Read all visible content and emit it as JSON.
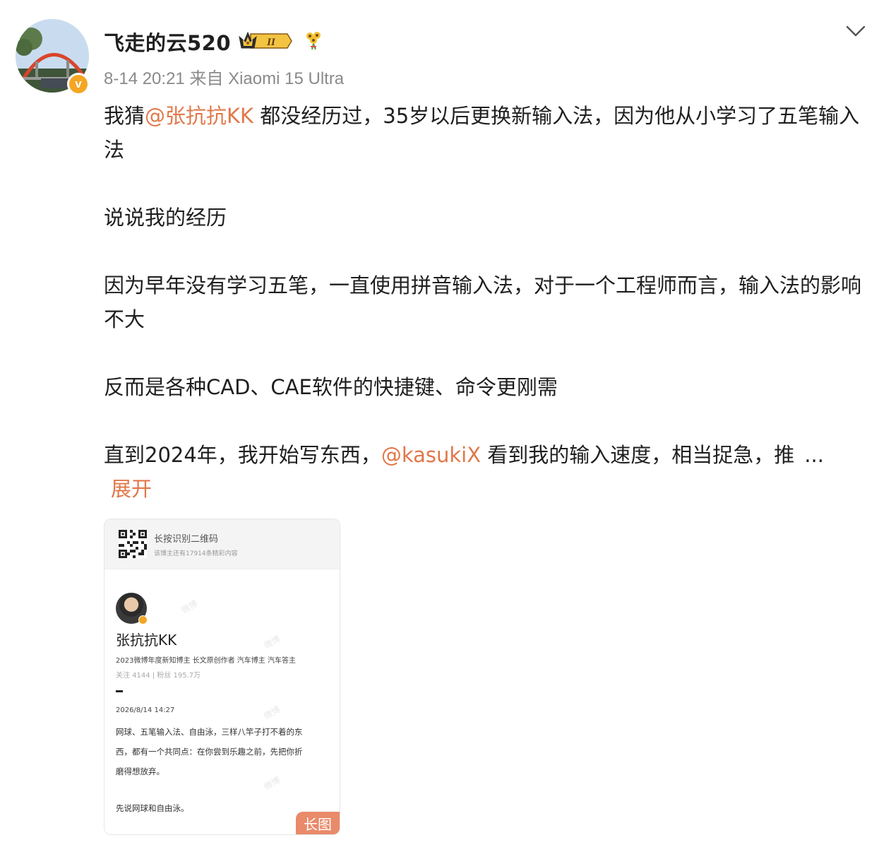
{
  "post": {
    "username": "飞走的云520",
    "meta": "8-14 20:21 来自 Xiaomi 15 Ultra",
    "verified_glyph": "v",
    "paragraph1": {
      "pre": "我猜",
      "mention": "@张抗抗KK",
      "post": " 都没经历过，35岁以后更换新输入法，因为他从小学习了五笔输入法"
    },
    "paragraph2": "说说我的经历",
    "paragraph3": "因为早年没有学习五笔，一直使用拼音输入法，对于一个工程师而言，输入法的影响不大",
    "paragraph4": "反而是各种CAD、CAE软件的快捷键、命令更刚需",
    "paragraph5": {
      "pre": "直到2024年，我开始写东西，",
      "mention": "@kasukiX",
      "post": " 看到我的输入速度，相当捉急，推",
      "ellipsis": "..."
    },
    "expand_label": "展开"
  },
  "card": {
    "qr_title": "长按识别二维码",
    "qr_subtitle": "该博主还有17914条精彩内容",
    "name": "张抗抗KK",
    "tags": "2023微博年度新知博主  长文原创作者 汽车博主 汽车答主",
    "stats": "关注 4144 | 粉丝 195.7万",
    "time": "2026/8/14 14:27",
    "body_line1": "网球、五笔输入法、自由泳，三样八竿子打不着的东",
    "body_line2": "西，都有一个共同点：在你尝到乐趣之前，先把你折",
    "body_line3": "磨得想放弃。",
    "bottom_line": "先说网球和自由泳。",
    "watermark": "微博",
    "long_badge": "长图"
  },
  "icons": {
    "chevron": "chevron-down-icon",
    "crown": "crown-badge-icon",
    "flower": "flower-badge-icon",
    "crown_level": "II"
  },
  "colors": {
    "mention": "#e0784a",
    "meta": "#8a8a8a",
    "badge_orange": "#f5a623",
    "long_badge_bg": "#e98a6a"
  }
}
